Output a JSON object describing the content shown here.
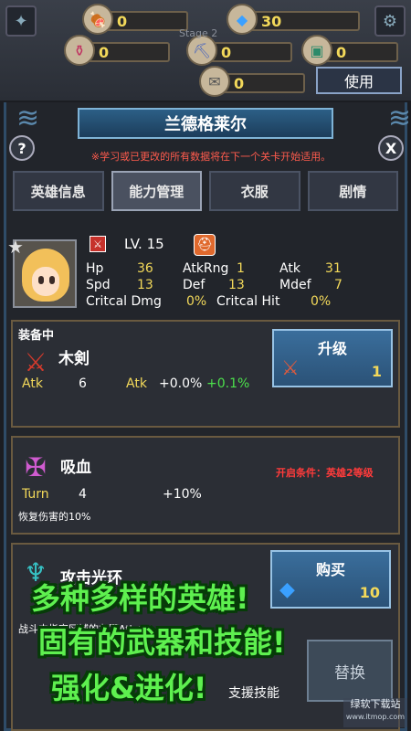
{
  "topbar": {
    "resources": [
      {
        "icon": "meat-icon",
        "value": "0"
      },
      {
        "icon": "diamond-icon",
        "value": "30"
      },
      {
        "icon": "potion-icon",
        "value": "0"
      },
      {
        "icon": "ore-icon",
        "value": "0"
      },
      {
        "icon": "chest-icon",
        "value": "0"
      },
      {
        "icon": "scroll-icon",
        "value": "0"
      }
    ],
    "use_label": "使用",
    "stage_label": "Stage 2"
  },
  "dialog": {
    "title": "兰德格莱尔",
    "help": "?",
    "close": "X",
    "notice": "※学习或已更改的所有数据将在下一个关卡开始适用。",
    "tabs": [
      "英雄信息",
      "能力管理",
      "衣服",
      "剧情"
    ],
    "active_tab": 1
  },
  "hero": {
    "level": "LV. 15",
    "stats": {
      "hp_label": "Hp",
      "hp": "36",
      "atkrng_label": "AtkRng",
      "atkrng": "1",
      "atk_label": "Atk",
      "atk": "31",
      "spd_label": "Spd",
      "spd": "13",
      "def_label": "Def",
      "def": "13",
      "mdef_label": "Mdef",
      "mdef": "7",
      "critdmg_label": "Critcal Dmg",
      "critdmg": "0%",
      "crithit_label": "Critcal Hit",
      "crithit": "0%"
    }
  },
  "equipment": {
    "section_label": "装备中",
    "name": "木剣",
    "stat_label": "Atk",
    "stat_value": "6",
    "bonus_label": "Atk",
    "bonus_base": "+0.0%",
    "bonus_next": "+0.1%",
    "upgrade_label": "升级",
    "upgrade_cost": "1"
  },
  "skill": {
    "name": "吸血",
    "turn_label": "Turn",
    "turn_value": "4",
    "effect": "+10%",
    "unlock_req": "开启条件：英雄2等级",
    "desc": "恢复伤害的10%"
  },
  "aura": {
    "name": "攻击光环",
    "buy_label": "购买",
    "buy_cost": "10",
    "desc": "战斗中指定区域的友军Atk+2",
    "support_label": "支援技能",
    "replace_label": "替换"
  },
  "promo": {
    "line1": "多种多样的英雄!",
    "line2": "固有的武器和技能!",
    "line3": "强化&进化!"
  },
  "watermark": {
    "text": "绿软下载站",
    "url": "www.itmop.com"
  }
}
